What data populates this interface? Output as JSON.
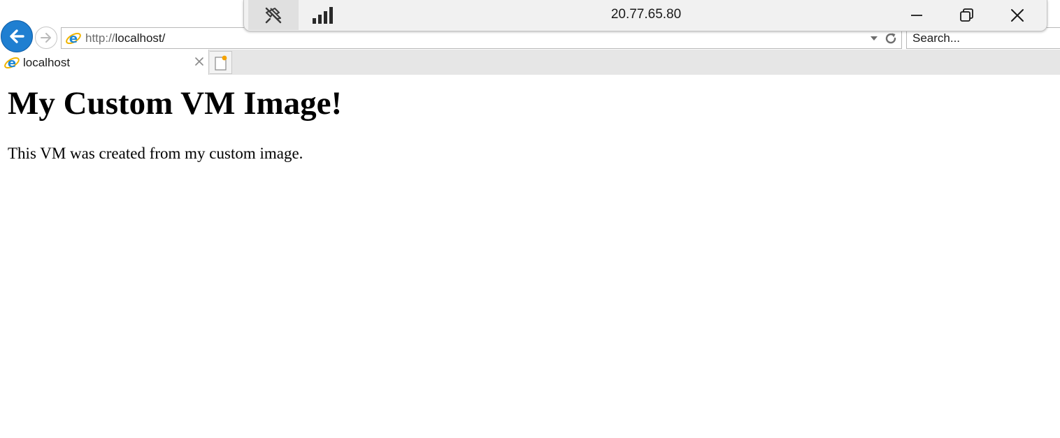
{
  "remote_bar": {
    "title": "20.77.65.80",
    "icons": [
      "unpin-icon",
      "connection-signal-icon",
      "minimize-icon",
      "restore-icon",
      "close-icon"
    ]
  },
  "navigation": {
    "back_icon": "back-arrow-icon",
    "forward_icon": "forward-arrow-icon"
  },
  "address_bar": {
    "scheme": "http://",
    "host_path": "localhost/",
    "site_icon": "ie-page-icon",
    "dropdown_icon": "chevron-down-icon",
    "refresh_icon": "refresh-icon"
  },
  "search_box": {
    "placeholder": "Search..."
  },
  "tabs": [
    {
      "label": "localhost",
      "icon": "ie-page-icon",
      "close_icon": "close-icon"
    }
  ],
  "new_tab_icon": "new-tab-icon",
  "page": {
    "heading": "My Custom VM Image!",
    "paragraph": "This VM was created from my custom image."
  },
  "colors": {
    "back_button": "#1f7fd1",
    "tab_strip": "#e6e6e6",
    "remote_bar": "#f1f1f1"
  }
}
